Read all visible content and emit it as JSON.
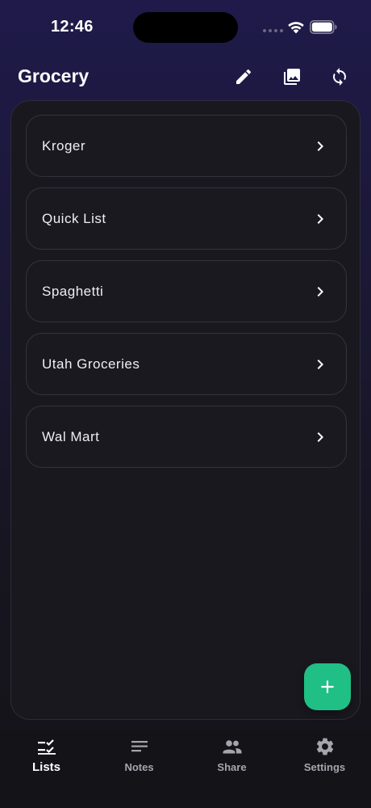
{
  "status_bar": {
    "time": "12:46"
  },
  "header": {
    "title": "Grocery",
    "edit_icon": "pencil-icon",
    "photo_icon": "photo-library-icon",
    "sync_icon": "sync-icon"
  },
  "lists": {
    "items": [
      {
        "label": "Kroger"
      },
      {
        "label": "Quick List"
      },
      {
        "label": "Spaghetti"
      },
      {
        "label": "Utah Groceries"
      },
      {
        "label": "Wal Mart"
      }
    ]
  },
  "fab": {
    "icon": "plus-icon",
    "color": "#1fbf85"
  },
  "bottom_nav": {
    "items": [
      {
        "label": "Lists",
        "icon": "checklist-icon",
        "active": true
      },
      {
        "label": "Notes",
        "icon": "notes-icon",
        "active": false
      },
      {
        "label": "Share",
        "icon": "people-icon",
        "active": false
      },
      {
        "label": "Settings",
        "icon": "gear-icon",
        "active": false
      }
    ]
  },
  "colors": {
    "accent": "#1fbf85",
    "background_top": "#1f1a4a",
    "panel": "#1a181f"
  }
}
